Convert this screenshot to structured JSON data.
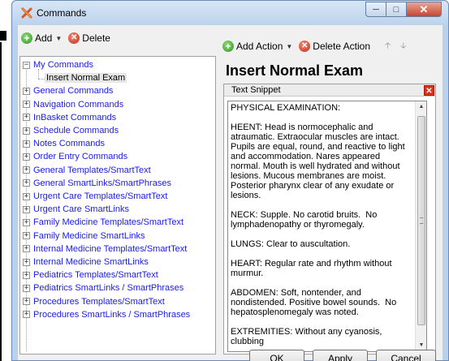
{
  "window": {
    "title": "Commands"
  },
  "left_toolbar": {
    "add_label": "Add",
    "delete_label": "Delete"
  },
  "tree": {
    "items": [
      {
        "label": "My Commands",
        "expanded": true
      },
      {
        "label": "Insert Normal Exam",
        "selected": true
      },
      {
        "label": "General Commands"
      },
      {
        "label": "Navigation Commands"
      },
      {
        "label": "InBasket Commands"
      },
      {
        "label": "Schedule Commands"
      },
      {
        "label": "Notes Commands"
      },
      {
        "label": "Order Entry Commands"
      },
      {
        "label": "General Templates/SmartText"
      },
      {
        "label": "General SmartLinks/SmartPhrases"
      },
      {
        "label": "Urgent Care Templates/SmartText"
      },
      {
        "label": "Urgent Care SmartLinks"
      },
      {
        "label": "Family Medicine Templates/SmartText"
      },
      {
        "label": "Family Medicine SmartLinks"
      },
      {
        "label": "Internal Medicine Templates/SmartText"
      },
      {
        "label": "Internal Medicine SmartLinks"
      },
      {
        "label": "Pediatrics Templates/SmartText"
      },
      {
        "label": "Pediatrics SmartLinks / SmartPhrases"
      },
      {
        "label": "Procedures Templates/SmartText"
      },
      {
        "label": "Procedures SmartLinks / SmartPhrases"
      }
    ]
  },
  "right_toolbar": {
    "add_action_label": "Add Action",
    "delete_action_label": "Delete Action"
  },
  "action_title": "Insert Normal Exam",
  "snippet": {
    "label": "Text Snippet",
    "paragraphs": [
      "PHYSICAL EXAMINATION:",
      "HEENT: Head is normocephalic and atraumatic. Extraocular muscles are intact. Pupils are equal, round, and reactive to light and accommodation. Nares appeared normal. Mouth is well hydrated and without lesions. Mucous membranes are moist. Posterior pharynx clear of any exudate or lesions.",
      "NECK: Supple. No carotid bruits.  No lymphadenopathy or thyromegaly.",
      "LUNGS: Clear to auscultation.",
      "HEART: Regular rate and rhythm without murmur.",
      "ABDOMEN: Soft, nontender, and nondistended. Positive bowel sounds.  No hepatosplenomegaly was noted.",
      "EXTREMITIES: Without any cyanosis, clubbing"
    ]
  },
  "buttons": {
    "ok": "OK",
    "apply": "Apply",
    "cancel": "Cancel"
  },
  "colors": {
    "link": "#1a1aee",
    "window_frame": "#b9d1ea",
    "close_red": "#d8321c"
  }
}
